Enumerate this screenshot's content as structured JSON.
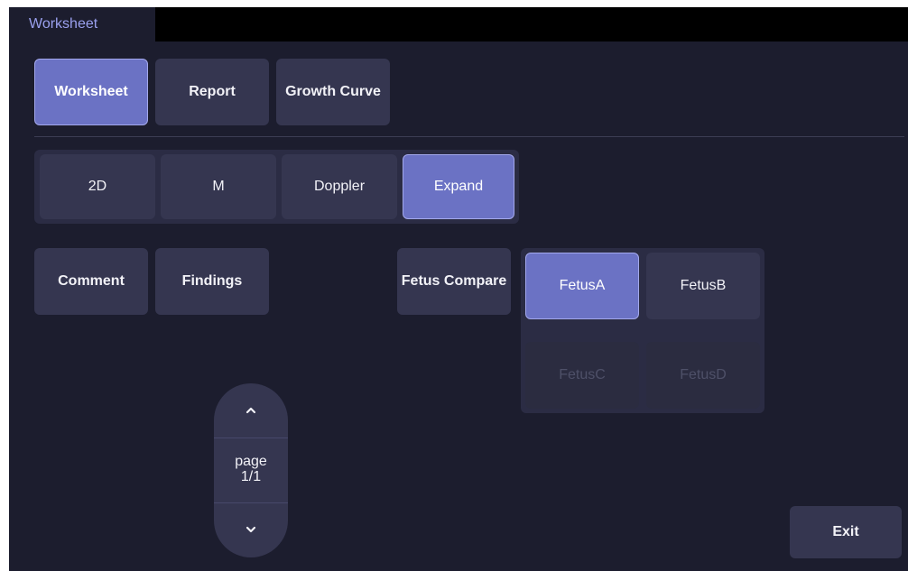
{
  "tabs": [
    {
      "label": "Worksheet"
    }
  ],
  "nav": {
    "worksheet": "Worksheet",
    "report": "Report",
    "growth_curve": "Growth Curve"
  },
  "modes": {
    "m2d": "2D",
    "m": "M",
    "doppler": "Doppler",
    "expand": "Expand"
  },
  "actions": {
    "comment": "Comment",
    "findings": "Findings",
    "fetus_compare": "Fetus Compare"
  },
  "fetus": {
    "a": "FetusA",
    "b": "FetusB",
    "c": "FetusC",
    "d": "FetusD"
  },
  "pager": {
    "page_word": "page",
    "page_value": "1/1",
    "up_icon": "chevron-up-icon",
    "down_icon": "chevron-down-icon"
  },
  "exit": "Exit",
  "colors": {
    "background": "#1c1d2e",
    "button": "#353650",
    "active": "#6b72c4",
    "tab_text": "#9aa0ee"
  }
}
